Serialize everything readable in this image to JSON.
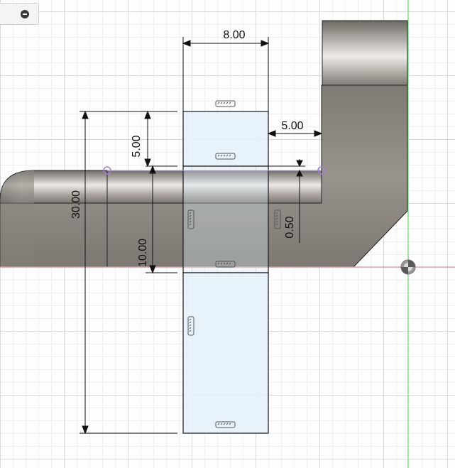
{
  "toolbar": {
    "collapse_icon": "minus-circle-icon"
  },
  "dimensions": {
    "width_top": "8.00",
    "offset_right": "5.00",
    "height_top": "5.00",
    "total_height": "30.00",
    "middle_height": "10.00",
    "gap_small": "0.50"
  },
  "colors": {
    "body_fill": "#8e8a83",
    "tube_highlight": "#e9e6e1",
    "sketch_fill": "#e6f1fb",
    "red_axis": "#e89a9a",
    "green_axis": "#6dd36d",
    "construction_point": "#9b7fd6"
  }
}
